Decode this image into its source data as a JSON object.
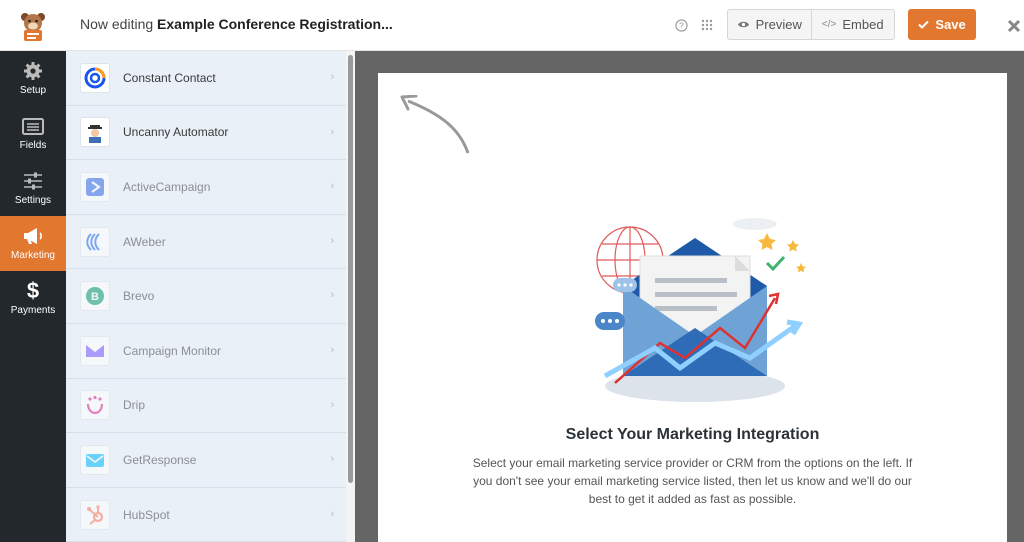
{
  "header": {
    "editing_prefix": "Now editing",
    "form_name": "Example Conference Registration...",
    "preview_label": "Preview",
    "embed_label": "Embed",
    "save_label": "Save",
    "icons": [
      "help-icon",
      "grid-icon",
      "eye-icon",
      "code-icon",
      "check-icon",
      "close-icon"
    ]
  },
  "nav": {
    "items": [
      {
        "label": "Setup",
        "icon": "gear-icon"
      },
      {
        "label": "Fields",
        "icon": "fields-icon"
      },
      {
        "label": "Settings",
        "icon": "sliders-icon"
      },
      {
        "label": "Marketing",
        "icon": "megaphone-icon",
        "active": true
      },
      {
        "label": "Payments",
        "icon": "dollar-icon"
      }
    ]
  },
  "providers": [
    {
      "label": "Constant Contact",
      "icon": "constant-contact-icon"
    },
    {
      "label": "Uncanny Automator",
      "icon": "uncanny-automator-icon"
    },
    {
      "label": "ActiveCampaign",
      "icon": "activecampaign-icon"
    },
    {
      "label": "AWeber",
      "icon": "aweber-icon"
    },
    {
      "label": "Brevo",
      "icon": "brevo-icon"
    },
    {
      "label": "Campaign Monitor",
      "icon": "campaign-monitor-icon"
    },
    {
      "label": "Drip",
      "icon": "drip-icon"
    },
    {
      "label": "GetResponse",
      "icon": "getresponse-icon"
    },
    {
      "label": "HubSpot",
      "icon": "hubspot-icon"
    }
  ],
  "main": {
    "title": "Select Your Marketing Integration",
    "description": "Select your email marketing service provider or CRM from the options on the left. If you don't see your email marketing service listed, then let us know and we'll do our best to get it added as fast as possible."
  },
  "colors": {
    "accent": "#e27730",
    "nav_bg": "#23282d",
    "list_bg": "#e9f0f7",
    "canvas_bg": "#656565"
  }
}
